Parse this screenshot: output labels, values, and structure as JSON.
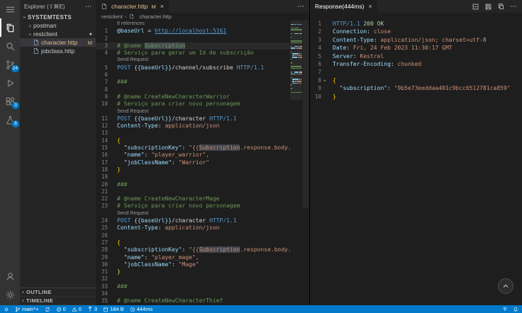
{
  "colors": {
    "accent": "#007acc",
    "comment": "#6a9955",
    "keyword": "#569cd6",
    "variable": "#9cdcfe",
    "string": "#ce9178",
    "number": "#b5cea8",
    "brace": "#ffd700",
    "link": "#569cd6",
    "plain": "#d4d4d4",
    "codelens": "#999999",
    "modified": "#e2c08d"
  },
  "activity_bar": {
    "top": [
      {
        "id": "menu",
        "icon": "menu-icon"
      },
      {
        "id": "explorer",
        "icon": "files-icon",
        "active": true
      },
      {
        "id": "search",
        "icon": "search-icon"
      },
      {
        "id": "source-control",
        "icon": "source-control-icon",
        "badge": "24"
      },
      {
        "id": "run-debug",
        "icon": "run-debug-icon"
      },
      {
        "id": "extensions",
        "icon": "extensions-icon",
        "badge": "3"
      },
      {
        "id": "testing",
        "icon": "beaker-icon",
        "badge": "8"
      }
    ],
    "bottom": [
      {
        "id": "account",
        "icon": "account-icon"
      },
      {
        "id": "settings",
        "icon": "gear-icon"
      }
    ]
  },
  "explorer": {
    "title": "Explorer (⇧⌘E)",
    "more": "⋯",
    "root": {
      "label": "SYSTEMTESTS",
      "expanded": true
    },
    "items": [
      {
        "label": "postman",
        "kind": "folder",
        "expanded": false,
        "depth": 1
      },
      {
        "label": "restclient",
        "kind": "folder",
        "expanded": true,
        "depth": 1,
        "dot": "●"
      },
      {
        "label": "character.http",
        "kind": "file",
        "depth": 2,
        "selected": true,
        "modified": true,
        "badge": "M"
      },
      {
        "label": "jobclass.http",
        "kind": "file",
        "depth": 2
      }
    ],
    "bottom_sections": [
      "OUTLINE",
      "TIMELINE"
    ]
  },
  "editor": {
    "tab": {
      "label": "character.http",
      "git_badge": "M",
      "close": "×"
    },
    "actions_more": "⋯",
    "breadcrumb": [
      "restclient",
      "character.http"
    ],
    "lines": [
      {
        "lens": "8 references"
      },
      {
        "n": 1,
        "s": [
          [
            "@baseUrl",
            "variable"
          ],
          [
            " = ",
            "plain"
          ],
          [
            "http://localhost:5161",
            "link"
          ]
        ]
      },
      {
        "n": 2,
        "s": []
      },
      {
        "n": 3,
        "active": true,
        "s": [
          [
            "# @name ",
            "comment"
          ],
          [
            "Subscription",
            "comment",
            "hl"
          ]
        ]
      },
      {
        "n": 4,
        "s": [
          [
            "# Serviço para gerar um Id de subscrição",
            "comment"
          ]
        ]
      },
      {
        "lens": "Send Request"
      },
      {
        "n": 5,
        "s": [
          [
            "POST",
            "keyword"
          ],
          [
            " ",
            "plain"
          ],
          [
            "{{baseUrl}}",
            "variable"
          ],
          [
            "/channel/subscribe",
            "plain"
          ],
          [
            " ",
            "plain"
          ],
          [
            "HTTP/1.1",
            "keyword"
          ]
        ]
      },
      {
        "n": 6,
        "s": []
      },
      {
        "n": 7,
        "s": [
          [
            "###",
            "comment"
          ]
        ]
      },
      {
        "n": 8,
        "s": []
      },
      {
        "n": 9,
        "s": [
          [
            "# @name CreateNewCharacterWarrior",
            "comment"
          ]
        ]
      },
      {
        "n": 10,
        "s": [
          [
            "# Serviço para criar novo personagem",
            "comment"
          ]
        ]
      },
      {
        "lens": "Send Request"
      },
      {
        "n": 11,
        "s": [
          [
            "POST",
            "keyword"
          ],
          [
            " ",
            "plain"
          ],
          [
            "{{baseUrl}}",
            "variable"
          ],
          [
            "/character",
            "plain"
          ],
          [
            " ",
            "plain"
          ],
          [
            "HTTP/1.1",
            "keyword"
          ]
        ]
      },
      {
        "n": 12,
        "s": [
          [
            "Content-Type",
            "variable"
          ],
          [
            ": ",
            "plain"
          ],
          [
            "application/json",
            "string"
          ]
        ]
      },
      {
        "n": 13,
        "s": []
      },
      {
        "n": 14,
        "s": [
          [
            "{",
            "brace"
          ]
        ]
      },
      {
        "n": 15,
        "s": [
          [
            "  ",
            "plain"
          ],
          [
            "\"subscriptionKey\"",
            "variable"
          ],
          [
            ": ",
            "plain"
          ],
          [
            "\"{{",
            "string"
          ],
          [
            "Subscription",
            "string",
            "hl"
          ],
          [
            ".response.body.subscription}}\",",
            "string"
          ]
        ]
      },
      {
        "n": 16,
        "s": [
          [
            "  ",
            "plain"
          ],
          [
            "\"name\"",
            "variable"
          ],
          [
            ": ",
            "plain"
          ],
          [
            "\"player_warrior\",",
            "string"
          ]
        ]
      },
      {
        "n": 17,
        "s": [
          [
            "  ",
            "plain"
          ],
          [
            "\"jobClassName\"",
            "variable"
          ],
          [
            ": ",
            "plain"
          ],
          [
            "\"Warrior\"",
            "string"
          ]
        ]
      },
      {
        "n": 18,
        "s": [
          [
            "}",
            "brace"
          ]
        ]
      },
      {
        "n": 19,
        "s": []
      },
      {
        "n": 20,
        "s": [
          [
            "###",
            "comment"
          ]
        ]
      },
      {
        "n": 21,
        "s": []
      },
      {
        "n": 22,
        "s": [
          [
            "# @name CreateNewCharacterMage",
            "comment"
          ]
        ]
      },
      {
        "n": 23,
        "s": [
          [
            "# Serviço para criar novo personagem",
            "comment"
          ]
        ]
      },
      {
        "lens": "Send Request"
      },
      {
        "n": 24,
        "s": [
          [
            "POST",
            "keyword"
          ],
          [
            " ",
            "plain"
          ],
          [
            "{{baseUrl}}",
            "variable"
          ],
          [
            "/character",
            "plain"
          ],
          [
            " ",
            "plain"
          ],
          [
            "HTTP/1.1",
            "keyword"
          ]
        ]
      },
      {
        "n": 25,
        "s": [
          [
            "Content-Type",
            "variable"
          ],
          [
            ": ",
            "plain"
          ],
          [
            "application/json",
            "string"
          ]
        ]
      },
      {
        "n": 26,
        "s": []
      },
      {
        "n": 27,
        "s": [
          [
            "{",
            "brace"
          ]
        ]
      },
      {
        "n": 28,
        "s": [
          [
            "  ",
            "plain"
          ],
          [
            "\"subscriptionKey\"",
            "variable"
          ],
          [
            ": ",
            "plain"
          ],
          [
            "\"{{",
            "string"
          ],
          [
            "Subscription",
            "string",
            "hl"
          ],
          [
            ".response.body.subscription}}\",",
            "string"
          ]
        ]
      },
      {
        "n": 29,
        "s": [
          [
            "  ",
            "plain"
          ],
          [
            "\"name\"",
            "variable"
          ],
          [
            ": ",
            "plain"
          ],
          [
            "\"player_mage\",",
            "string"
          ]
        ]
      },
      {
        "n": 30,
        "s": [
          [
            "  ",
            "plain"
          ],
          [
            "\"jobClassName\"",
            "variable"
          ],
          [
            ": ",
            "plain"
          ],
          [
            "\"Mage\"",
            "string"
          ]
        ]
      },
      {
        "n": 31,
        "s": [
          [
            "}",
            "brace"
          ]
        ]
      },
      {
        "n": 32,
        "s": []
      },
      {
        "n": 33,
        "s": [
          [
            "###",
            "comment"
          ]
        ]
      },
      {
        "n": 34,
        "s": []
      },
      {
        "n": 35,
        "s": [
          [
            "# @name CreateNewCharacterThief",
            "comment"
          ]
        ]
      }
    ]
  },
  "response": {
    "tab": {
      "label": "Response(444ms)",
      "close": "×"
    },
    "actions": [
      {
        "id": "fold",
        "icon": "collapse-all-icon"
      },
      {
        "id": "save",
        "icon": "save-icon"
      },
      {
        "id": "copy",
        "icon": "copy-icon"
      },
      {
        "id": "more",
        "icon": "more-icon",
        "glyph": "⋯"
      }
    ],
    "lines": [
      {
        "n": 1,
        "s": [
          [
            "HTTP/1.1",
            "keyword"
          ],
          [
            " ",
            "plain"
          ],
          [
            "200 OK",
            "number"
          ]
        ]
      },
      {
        "n": 2,
        "s": [
          [
            "Connection",
            "variable"
          ],
          [
            ": ",
            "plain"
          ],
          [
            "close",
            "string"
          ]
        ]
      },
      {
        "n": 3,
        "s": [
          [
            "Content-Type",
            "variable"
          ],
          [
            ": ",
            "plain"
          ],
          [
            "application/json; charset=utf-8",
            "string"
          ]
        ]
      },
      {
        "n": 4,
        "s": [
          [
            "Date",
            "variable"
          ],
          [
            ": ",
            "plain"
          ],
          [
            "Fri, 24 Feb 2023 11:30:17 GMT",
            "string"
          ]
        ]
      },
      {
        "n": 5,
        "s": [
          [
            "Server",
            "variable"
          ],
          [
            ": ",
            "plain"
          ],
          [
            "Kestrel",
            "string"
          ]
        ]
      },
      {
        "n": 6,
        "s": [
          [
            "Transfer-Encoding",
            "variable"
          ],
          [
            ": ",
            "plain"
          ],
          [
            "chunked",
            "string"
          ]
        ]
      },
      {
        "n": 7,
        "s": []
      },
      {
        "n": 8,
        "fold": true,
        "s": [
          [
            "{",
            "brace"
          ]
        ]
      },
      {
        "n": 9,
        "s": [
          [
            "  ",
            "plain"
          ],
          [
            "\"subscription\"",
            "variable"
          ],
          [
            ": ",
            "plain"
          ],
          [
            "\"0b5e73eeddaa401c9bcc6512781ca859\"",
            "string"
          ]
        ]
      },
      {
        "n": 10,
        "s": [
          [
            "}",
            "brace"
          ]
        ]
      }
    ]
  },
  "status_bar": {
    "left": [
      {
        "id": "remote",
        "icon": "remote-icon",
        "label": ""
      },
      {
        "id": "branch",
        "icon": "git-branch-icon",
        "label": "main*+"
      },
      {
        "id": "sync",
        "icon": "sync-icon",
        "label": ""
      },
      {
        "id": "errors",
        "icon": "error-icon",
        "label": "0"
      },
      {
        "id": "warnings",
        "icon": "warning-icon",
        "label": "0"
      },
      {
        "id": "ports",
        "icon": "ports-icon",
        "label": "3"
      },
      {
        "id": "response-size",
        "icon": "database-icon",
        "label": "184 B"
      },
      {
        "id": "response-time",
        "icon": "clock-icon",
        "label": "444ms"
      }
    ],
    "right": [
      {
        "id": "broadcast",
        "icon": "broadcast-icon",
        "label": ""
      },
      {
        "id": "notifications",
        "icon": "bell-icon",
        "label": ""
      }
    ]
  }
}
